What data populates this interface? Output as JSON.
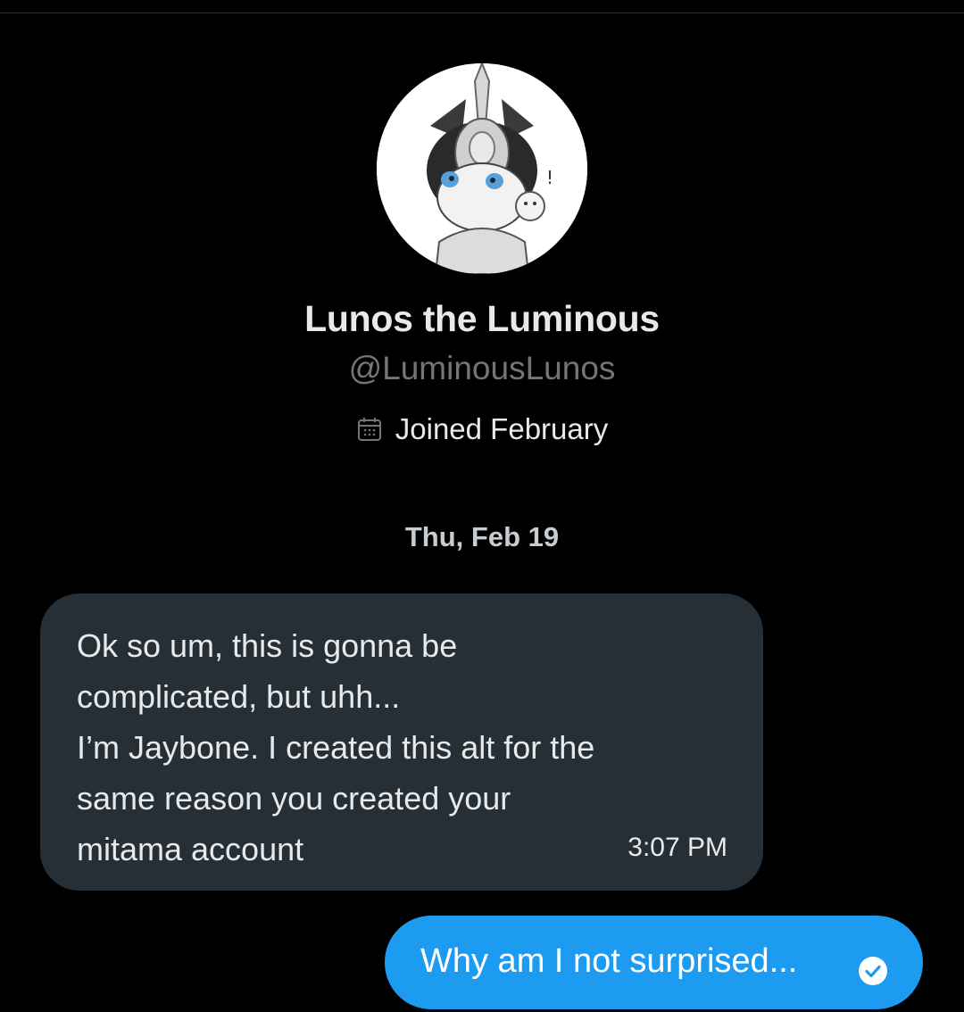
{
  "profile": {
    "display_name": "Lunos the Luminous",
    "handle": "@LuminousLunos",
    "joined": "Joined February",
    "avatar_alt": "avatar"
  },
  "conversation": {
    "date_separator": "Thu, Feb 19",
    "messages": [
      {
        "direction": "incoming",
        "text": "Ok so um, this is gonna be\ncomplicated, but uhh...\nI’m Jaybone. I created this alt for the\nsame reason you created your\nmitama account",
        "time": "3:07 PM"
      },
      {
        "direction": "outgoing",
        "text": "Why am I not surprised...",
        "status_icon": "read-check-icon"
      }
    ]
  },
  "colors": {
    "background": "#000000",
    "incoming_bubble": "#262f35",
    "outgoing_bubble": "#1d9bf0",
    "primary_text": "#e7e9ea",
    "secondary_text": "#71767b"
  }
}
